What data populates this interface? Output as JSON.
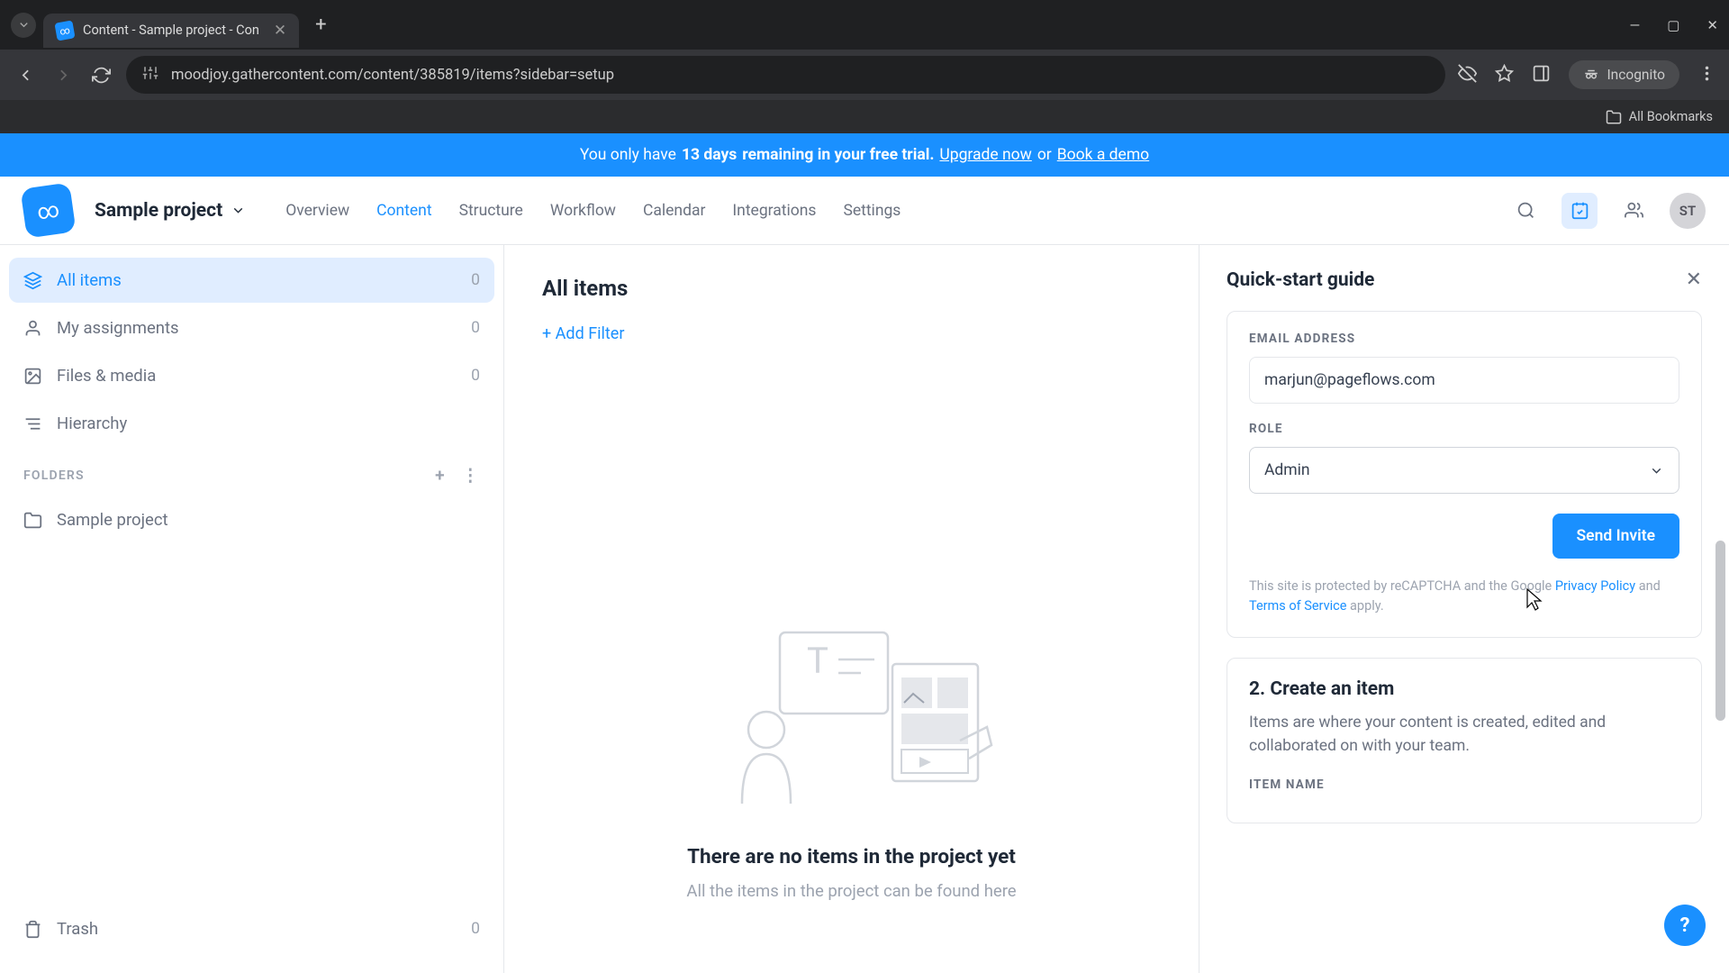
{
  "browser": {
    "tab_title": "Content - Sample project - Con",
    "url": "moodjoy.gathercontent.com/content/385819/items?sidebar=setup",
    "incognito_label": "Incognito",
    "all_bookmarks": "All Bookmarks"
  },
  "trial": {
    "prefix": "You only have ",
    "days": "13 days",
    "mid": " remaining in your free trial. ",
    "upgrade": "Upgrade now",
    "or": " or ",
    "demo": "Book a demo"
  },
  "header": {
    "project": "Sample project",
    "nav": {
      "overview": "Overview",
      "content": "Content",
      "structure": "Structure",
      "workflow": "Workflow",
      "calendar": "Calendar",
      "integrations": "Integrations",
      "settings": "Settings"
    },
    "avatar": "ST"
  },
  "sidebar": {
    "all_items": {
      "label": "All items",
      "count": "0"
    },
    "my_assign": {
      "label": "My assignments",
      "count": "0"
    },
    "files": {
      "label": "Files & media",
      "count": "0"
    },
    "hierarchy": {
      "label": "Hierarchy"
    },
    "folders_section": "FOLDERS",
    "folder1": "Sample project",
    "trash": {
      "label": "Trash",
      "count": "0"
    }
  },
  "content": {
    "title": "All items",
    "add_filter": "+ Add Filter",
    "empty_title": "There are no items in the project yet",
    "empty_sub": "All the items in the project can be found here"
  },
  "guide": {
    "title": "Quick-start guide",
    "email_label": "EMAIL ADDRESS",
    "email_value": "marjun@pageflows.com",
    "role_label": "ROLE",
    "role_value": "Admin",
    "send": "Send Invite",
    "recaptcha_pre": "This site is protected by reCAPTCHA and the Google ",
    "privacy": "Privacy Policy",
    "and": " and ",
    "tos": "Terms of Service",
    "apply": " apply.",
    "step2_title": "2. Create an item",
    "step2_text": "Items are where your content is created, edited and collaborated on with your team.",
    "item_name_label": "ITEM NAME"
  }
}
